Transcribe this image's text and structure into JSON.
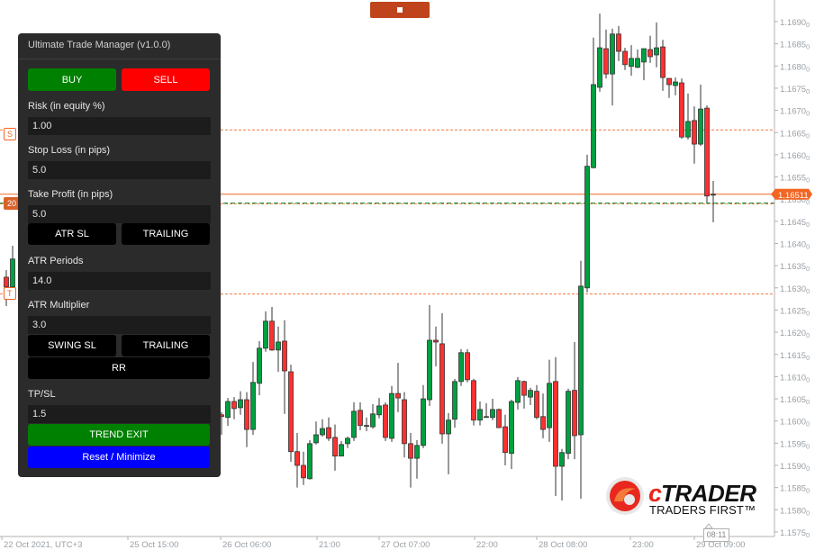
{
  "panel": {
    "title": "Ultimate Trade Manager (v1.0.0)",
    "buy_label": "BUY",
    "sell_label": "SELL",
    "risk_label": "Risk (in equity %)",
    "risk_value": "1.00",
    "stop_loss_label": "Stop Loss (in pips)",
    "stop_loss_value": "5.0",
    "take_profit_label": "Take Profit (in pips)",
    "take_profit_value": "5.0",
    "atr_sl_label": "ATR SL",
    "trailing_label_1": "TRAILING",
    "atr_periods_label": "ATR Periods",
    "atr_periods_value": "14.0",
    "atr_multiplier_label": "ATR Multiplier",
    "atr_multiplier_value": "3.0",
    "swing_sl_label": "SWING SL",
    "trailing_label_2": "TRAILING",
    "rr_label": "RR",
    "tpsl_label": "TP/SL",
    "tpsl_value": "1.5",
    "trend_exit_label": "TREND EXIT",
    "reset_label": "Reset / Minimize"
  },
  "colors": {
    "buy": "#008000",
    "sell": "#ff0000",
    "reset": "#0000ff",
    "bull": "#00a040",
    "bear": "#ff3030",
    "line": "#f26522",
    "entry": "#2e9a4a"
  },
  "chart": {
    "current_price": "1.16511",
    "price_axis": [
      "1.1690",
      "1.1685",
      "1.1680",
      "1.1675",
      "1.1670",
      "1.1665",
      "1.1660",
      "1.1655",
      "1.1650",
      "1.1645",
      "1.1640",
      "1.1635",
      "1.1630",
      "1.1625",
      "1.1620",
      "1.1615",
      "1.1610",
      "1.1605",
      "1.1600",
      "1.1595",
      "1.1590",
      "1.1585",
      "1.1580",
      "1.1575"
    ],
    "time_axis": [
      "22 Oct 2021, UTC+3",
      "25 Oct 15:00",
      "26 Oct 06:00",
      "21:00",
      "27 Oct 07:00",
      "22:00",
      "28 Oct 08:00",
      "23:00",
      "29 Oct 09:00"
    ],
    "cursor_time": "08:11",
    "stop_loss_price": 1.16656,
    "entry_price": 1.16489,
    "take_profit_price": 1.16286,
    "tag_sl": "S",
    "tag_entry": "20",
    "tag_tp": "T",
    "left_candles": [
      [
        1.16324,
        1.16302,
        1.1634,
        1.16259
      ],
      [
        1.16302,
        1.16365,
        1.16395,
        1.163
      ]
    ],
    "candles": [
      [
        1.16014,
        1.1601,
        1.1602,
        1.15969
      ],
      [
        1.16008,
        1.16044,
        1.16052,
        1.15989
      ],
      [
        1.16044,
        1.16028,
        1.16054,
        1.16004
      ],
      [
        1.1603,
        1.16048,
        1.16067,
        1.16014
      ],
      [
        1.16048,
        1.15981,
        1.16065,
        1.15941
      ],
      [
        1.15981,
        1.16087,
        1.16133,
        1.15969
      ],
      [
        1.16085,
        1.16164,
        1.1618,
        1.16058
      ],
      [
        1.16164,
        1.16225,
        1.16247,
        1.16156
      ],
      [
        1.16225,
        1.1616,
        1.16257,
        1.16158
      ],
      [
        1.1616,
        1.16178,
        1.16213,
        1.16111
      ],
      [
        1.1618,
        1.16113,
        1.16227,
        1.16016
      ],
      [
        1.16111,
        1.15931,
        1.16127,
        1.15908
      ],
      [
        1.15931,
        1.159,
        1.15973,
        1.1585
      ],
      [
        1.159,
        1.15872,
        1.15931,
        1.15856
      ],
      [
        1.1587,
        1.15949,
        1.15957,
        1.15868
      ],
      [
        1.15951,
        1.15969,
        1.15999,
        1.15947
      ],
      [
        1.15969,
        1.15983,
        1.16004,
        1.15965
      ],
      [
        1.15985,
        1.15961,
        1.16008,
        1.15955
      ],
      [
        1.15963,
        1.15921,
        1.15992,
        1.15888
      ],
      [
        1.15921,
        1.15947,
        1.15955,
        1.15921
      ],
      [
        1.15949,
        1.15961,
        1.15965,
        1.15939
      ],
      [
        1.15963,
        1.16022,
        1.16042,
        1.15955
      ],
      [
        1.16024,
        1.1599,
        1.16042,
        1.15979
      ],
      [
        1.1599,
        1.1599,
        1.16008,
        1.15977
      ],
      [
        1.15987,
        1.16016,
        1.16038,
        1.15983
      ],
      [
        1.16014,
        1.16034,
        1.16052,
        1.16006
      ],
      [
        1.16036,
        1.15963,
        1.16042,
        1.15955
      ],
      [
        1.15961,
        1.16062,
        1.16079,
        1.15953
      ],
      [
        1.16062,
        1.16052,
        1.16131,
        1.1602
      ],
      [
        1.16048,
        1.15949,
        1.16065,
        1.15918
      ],
      [
        1.15949,
        1.15916,
        1.15973,
        1.1585
      ],
      [
        1.15916,
        1.15945,
        1.15957,
        1.1587
      ],
      [
        1.15945,
        1.1605,
        1.16081,
        1.15939
      ],
      [
        1.16048,
        1.16182,
        1.16261,
        1.16034
      ],
      [
        1.16182,
        1.16178,
        1.16213,
        1.16123
      ],
      [
        1.16174,
        1.15971,
        1.16243,
        1.15949
      ],
      [
        1.15971,
        1.16002,
        1.16018,
        1.1588
      ],
      [
        1.16004,
        1.16089,
        1.16095,
        1.15985
      ],
      [
        1.16089,
        1.16154,
        1.16162,
        1.16079
      ],
      [
        1.16154,
        1.16093,
        1.16162,
        1.16087
      ],
      [
        1.16091,
        1.16002,
        1.16095,
        1.1599
      ],
      [
        1.16002,
        1.16026,
        1.16044,
        1.1599
      ],
      [
        1.1601,
        1.1601,
        1.1604,
        1.1601
      ],
      [
        1.16008,
        1.16026,
        1.1605,
        1.16002
      ],
      [
        1.16026,
        1.15985,
        1.16028,
        1.15985
      ],
      [
        1.15987,
        1.15929,
        1.16014,
        1.159
      ],
      [
        1.15927,
        1.16044,
        1.16048,
        1.15892
      ],
      [
        1.16042,
        1.16091,
        1.16099,
        1.16026
      ],
      [
        1.16089,
        1.16058,
        1.16091,
        1.16028
      ],
      [
        1.16054,
        1.16069,
        1.16075,
        1.16036
      ],
      [
        1.16067,
        1.16008,
        1.16081,
        1.16004
      ],
      [
        1.1601,
        1.15981,
        1.16062,
        1.15961
      ],
      [
        1.15985,
        1.16085,
        1.16138,
        1.15953
      ],
      [
        1.16089,
        1.15898,
        1.16144,
        1.15831
      ],
      [
        1.15898,
        1.15929,
        1.15937,
        1.15821
      ],
      [
        1.15927,
        1.16067,
        1.16073,
        1.15914
      ],
      [
        1.16069,
        1.15967,
        1.16178,
        1.15914
      ],
      [
        1.15969,
        1.16304,
        1.16361,
        1.15825
      ],
      [
        1.163,
        1.16574,
        1.166,
        1.1629
      ],
      [
        1.16571,
        1.16758,
        1.16864,
        1.16569
      ],
      [
        1.16752,
        1.16841,
        1.16918,
        1.16742
      ],
      [
        1.16839,
        1.16782,
        1.16882,
        1.16772
      ],
      [
        1.16782,
        1.16872,
        1.16884,
        1.16711
      ],
      [
        1.16872,
        1.16833,
        1.1689,
        1.16811
      ],
      [
        1.16833,
        1.16803,
        1.16841,
        1.16791
      ],
      [
        1.16799,
        1.16817,
        1.16847,
        1.16778
      ],
      [
        1.16797,
        1.16817,
        1.16837,
        1.16795
      ],
      [
        1.16809,
        1.16839,
        1.16839,
        1.16768
      ],
      [
        1.16837,
        1.16821,
        1.16868,
        1.16807
      ],
      [
        1.16825,
        1.16841,
        1.16898,
        1.16797
      ],
      [
        1.16843,
        1.16774,
        1.16859,
        1.16744
      ],
      [
        1.16772,
        1.16758,
        1.16772,
        1.16728
      ],
      [
        1.16756,
        1.16764,
        1.16774,
        1.16734
      ],
      [
        1.16762,
        1.1664,
        1.16772,
        1.16636
      ],
      [
        1.1664,
        1.16675,
        1.16738,
        1.16634
      ],
      [
        1.16677,
        1.16624,
        1.16709,
        1.1658
      ],
      [
        1.16624,
        1.16703,
        1.16758,
        1.1662
      ],
      [
        1.16705,
        1.16507,
        1.16711,
        1.16492
      ],
      [
        1.16511,
        1.16511,
        1.16541,
        1.16448
      ]
    ]
  },
  "logo": {
    "brand": "cTRADER",
    "tagline": "TRADERS FIRST™"
  }
}
